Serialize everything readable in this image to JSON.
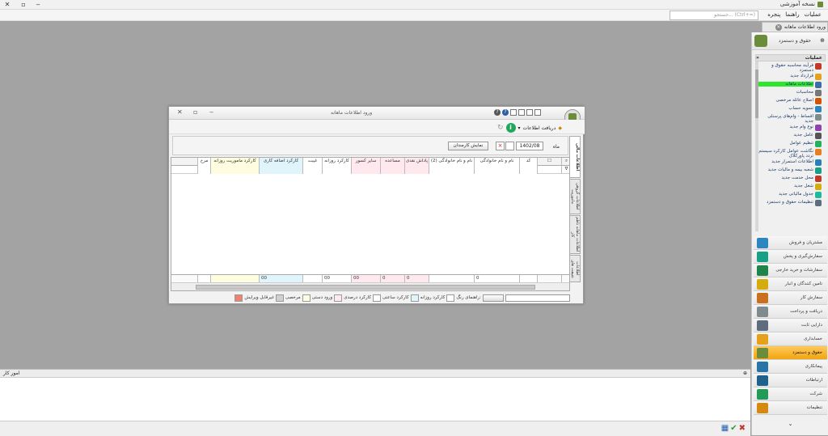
{
  "app": {
    "title": "نسخه آموزشی"
  },
  "menu": {
    "items": [
      "عملیات",
      "راهنما",
      "پنجره"
    ],
    "search_placeholder": "جستجو... (Ctrl+=)"
  },
  "doc_tab": {
    "label": "ورود اطلاعات ماهانه"
  },
  "right_panel": {
    "header": "حقوق و دستمزد",
    "section": "عملیات",
    "operations": [
      {
        "label": "فرآیند محاسبه حقوق و دستمزد",
        "color": "#c0392b"
      },
      {
        "label": "قرارداد جدید",
        "color": "#e6a11a"
      },
      {
        "label": "اطلاعات ماهانه",
        "color": "#3b6ea8",
        "highlight": true
      },
      {
        "label": "محاسبات",
        "color": "#777777"
      },
      {
        "label": "اصلاح عائله مرخصی",
        "color": "#d35400"
      },
      {
        "label": "تسویه حساب",
        "color": "#2e86c1"
      },
      {
        "label": "اقساط - وام‌های پرسنلی جدید",
        "color": "#7f8c8d"
      },
      {
        "label": "نوع وام جدید",
        "color": "#8e44ad"
      },
      {
        "label": "عامل جدید",
        "color": "#555555"
      },
      {
        "label": "تنظیم عوامل",
        "color": "#27ae60"
      },
      {
        "label": "نگاشت عوامل کارکرد سیستم تردد پاورکلاک",
        "color": "#e67e22"
      },
      {
        "label": "اطلاعات استمرار جدید",
        "color": "#2980b9"
      },
      {
        "label": "شعبه بیمه و مالیات جدید",
        "color": "#16a085"
      },
      {
        "label": "محل خدمت جدید",
        "color": "#c0392b"
      },
      {
        "label": "شغل جدید",
        "color": "#d4ac0d"
      },
      {
        "label": "جدول مالیاتی جدید",
        "color": "#1abc9c"
      },
      {
        "label": "تنظیمات حقوق و دستمزد",
        "color": "#5d6d7e"
      }
    ],
    "nav": [
      {
        "label": "مشتریان و فروش",
        "color": "#2e86c1"
      },
      {
        "label": "سفارش‌گیری و پخش",
        "color": "#16a085"
      },
      {
        "label": "سفارشات و خرید خارجی",
        "color": "#1e8449"
      },
      {
        "label": "تامین کنندگان و انبار",
        "color": "#d4ac0d"
      },
      {
        "label": "سفارش کار",
        "color": "#ca6f1e"
      },
      {
        "label": "دریافت و پرداخت",
        "color": "#7f8c8d"
      },
      {
        "label": "دارایی ثابت",
        "color": "#5d6d7e"
      },
      {
        "label": "حسابداری",
        "color": "#e6a11a"
      },
      {
        "label": "حقوق و دستمزد",
        "color": "#6b8c3a",
        "active": true
      },
      {
        "label": "پیمانکاری",
        "color": "#2874a6"
      },
      {
        "label": "ارتباطات",
        "color": "#1f618d"
      },
      {
        "label": "شرکت",
        "color": "#239b56"
      },
      {
        "label": "تنظیمات",
        "color": "#d68910"
      }
    ]
  },
  "output_panel": {
    "title": "امور کار"
  },
  "dialog": {
    "title": "ورود اطلاعات ماهانه",
    "ribbon_label": "دریافت اطلاعات",
    "vtabs": [
      "اطلاعات مالی",
      "اطلاعات گروهی ماموریت",
      "اطلاعات ماهانه ناظم کار",
      "اطلاعات شیفت های پرسنل"
    ],
    "filter": {
      "month_label": "ماه",
      "month_value": "1402/08",
      "show_button": "نمایش کارمندان"
    },
    "columns": [
      {
        "label": "کد",
        "w": 22,
        "color": "#ffffff"
      },
      {
        "label": "نام و نام خانوادگی",
        "w": 56,
        "color": "#ffffff"
      },
      {
        "label": "نام و نام خانوادگی (2)",
        "w": 56,
        "color": "#ffffff"
      },
      {
        "label": "پاداش نقدی",
        "w": 30,
        "color": "#ffe9ee"
      },
      {
        "label": "مساعده",
        "w": 30,
        "color": "#ffe9ee"
      },
      {
        "label": "سایر کسور",
        "w": 36,
        "color": "#ffe9ee"
      },
      {
        "label": "کارکرد روزانه",
        "w": 36,
        "color": "#ffffff"
      },
      {
        "label": "غیبت",
        "w": 24,
        "color": "#ffffff"
      },
      {
        "label": "کارکرد اضافه کاری",
        "w": 54,
        "color": "#dff4fb"
      },
      {
        "label": "کارکرد ماموریت روزانه",
        "w": 60,
        "color": "#fffde0"
      },
      {
        "label": "مرخ",
        "w": 16,
        "color": "#ffffff"
      }
    ],
    "totals": [
      "",
      "0",
      "",
      "0",
      "0",
      "00",
      "00",
      "",
      "00",
      "",
      ""
    ],
    "legend": {
      "title": "راهنمای رنگ:",
      "items": [
        {
          "label": "کارکرد روزانه",
          "color": "#ffffff"
        },
        {
          "label": "کارکرد ساعتی",
          "color": "#dff4fb"
        },
        {
          "label": "کارکرد درصدی",
          "color": "#ffffff"
        },
        {
          "label": "ورود دستی",
          "color": "#ffe9ee"
        },
        {
          "label": "مرخصی",
          "color": "#fffde0"
        },
        {
          "label": "غیرقابل ویرایش",
          "color": "#d0d0d0"
        }
      ],
      "last_swatch": "#f08070"
    }
  }
}
